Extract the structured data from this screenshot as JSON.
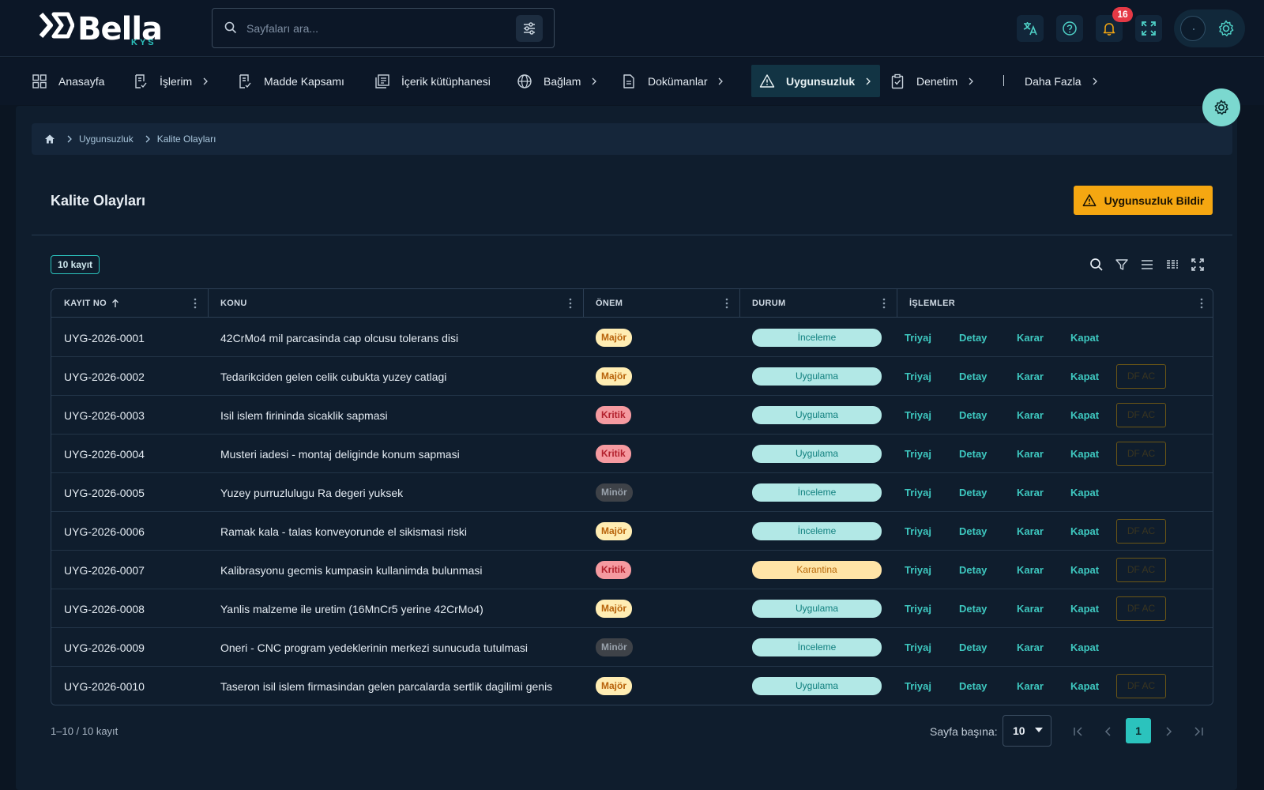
{
  "app": {
    "logo_text": "Bella",
    "logo_sub": "KYS"
  },
  "search": {
    "placeholder": "Sayfaları ara..."
  },
  "topbar": {
    "icons": [
      "translate-icon",
      "help-icon",
      "bell-icon",
      "fullscreen-icon",
      "avatar",
      "gear-icon"
    ],
    "notification_count": "16"
  },
  "nav": {
    "items": [
      {
        "label": "Anasayfa",
        "icon": "dashboard-icon",
        "chevron": false
      },
      {
        "label": "İşlerim",
        "icon": "task-icon",
        "chevron": true
      },
      {
        "label": "Madde Kapsamı",
        "icon": "doc-check-icon",
        "chevron": false
      },
      {
        "label": "İçerik kütüphanesi",
        "icon": "library-icon",
        "chevron": false
      },
      {
        "label": "Bağlam",
        "icon": "globe-icon",
        "chevron": true
      },
      {
        "label": "Dokümanlar",
        "icon": "document-icon",
        "chevron": true
      },
      {
        "label": "Uygunsuzluk",
        "icon": "warning-icon",
        "chevron": true,
        "active": true
      },
      {
        "label": "Denetim",
        "icon": "clipboard-check-icon",
        "chevron": true
      },
      {
        "label": "Daha Fazla",
        "icon": "more-icon",
        "chevron": true
      }
    ]
  },
  "breadcrumb": {
    "home_icon": "home-icon",
    "items": [
      "Uygunsuzluk",
      "Kalite Olayları"
    ]
  },
  "page": {
    "title": "Kalite Olayları",
    "report_button": "Uygunsuzluk Bildir",
    "record_count": "10 kayıt"
  },
  "table": {
    "columns": [
      "KAYIT NO",
      "KONU",
      "ÖNEM",
      "DURUM",
      "İŞLEMLER"
    ],
    "sort": {
      "column": "KAYIT NO",
      "direction": "asc"
    },
    "actions": [
      "Triyaj",
      "Detay",
      "Karar",
      "Kapat"
    ],
    "rows": [
      {
        "id": "UYG-2026-0001",
        "subject": "42CrMo4 mil parcasinda cap olcusu tolerans disi",
        "severity": "Majör",
        "sev_class": "major",
        "status": "İnceleme",
        "stat_class": "teal",
        "extra": ""
      },
      {
        "id": "UYG-2026-0002",
        "subject": "Tedarikciden gelen celik cubukta yuzey catlagi",
        "severity": "Majör",
        "sev_class": "major",
        "status": "Uygulama",
        "stat_class": "teal",
        "extra": "DF AC"
      },
      {
        "id": "UYG-2026-0003",
        "subject": "Isil islem firininda sicaklik sapmasi",
        "severity": "Kritik",
        "sev_class": "kritik",
        "status": "Uygulama",
        "stat_class": "teal",
        "extra": "DF AC"
      },
      {
        "id": "UYG-2026-0004",
        "subject": "Musteri iadesi - montaj deliginde konum sapmasi",
        "severity": "Kritik",
        "sev_class": "kritik",
        "status": "Uygulama",
        "stat_class": "teal",
        "extra": "DF AC"
      },
      {
        "id": "UYG-2026-0005",
        "subject": "Yuzey purruzlulugu Ra degeri yuksek",
        "severity": "Minör",
        "sev_class": "minor",
        "status": "İnceleme",
        "stat_class": "teal",
        "extra": ""
      },
      {
        "id": "UYG-2026-0006",
        "subject": "Ramak kala - talas konveyorunde el sikismasi riski",
        "severity": "Majör",
        "sev_class": "major",
        "status": "İnceleme",
        "stat_class": "teal",
        "extra": "DF AC"
      },
      {
        "id": "UYG-2026-0007",
        "subject": "Kalibrasyonu gecmis kumpasin kullanimda bulunmasi",
        "severity": "Kritik",
        "sev_class": "kritik",
        "status": "Karantina",
        "stat_class": "amber",
        "extra": "DF AC"
      },
      {
        "id": "UYG-2026-0008",
        "subject": "Yanlis malzeme ile uretim (16MnCr5 yerine 42CrMo4)",
        "severity": "Majör",
        "sev_class": "major",
        "status": "Uygulama",
        "stat_class": "teal",
        "extra": "DF AC"
      },
      {
        "id": "UYG-2026-0009",
        "subject": "Oneri - CNC program yedeklerinin merkezi sunucuda tutulmasi",
        "severity": "Minör",
        "sev_class": "minor",
        "status": "İnceleme",
        "stat_class": "teal",
        "extra": ""
      },
      {
        "id": "UYG-2026-0010",
        "subject": "Taseron isil islem firmasindan gelen parcalarda sertlik dagilimi genis",
        "severity": "Majör",
        "sev_class": "major",
        "status": "Uygulama",
        "stat_class": "teal",
        "extra": "DF AC"
      }
    ]
  },
  "footer": {
    "range": "1–10 / 10 kayıt",
    "per_page_label": "Sayfa başına:",
    "per_page_value": "10",
    "current_page": "1"
  },
  "colors": {
    "accent": "#2bc3bd",
    "warning": "#f5a711",
    "background": "#0b1522"
  }
}
